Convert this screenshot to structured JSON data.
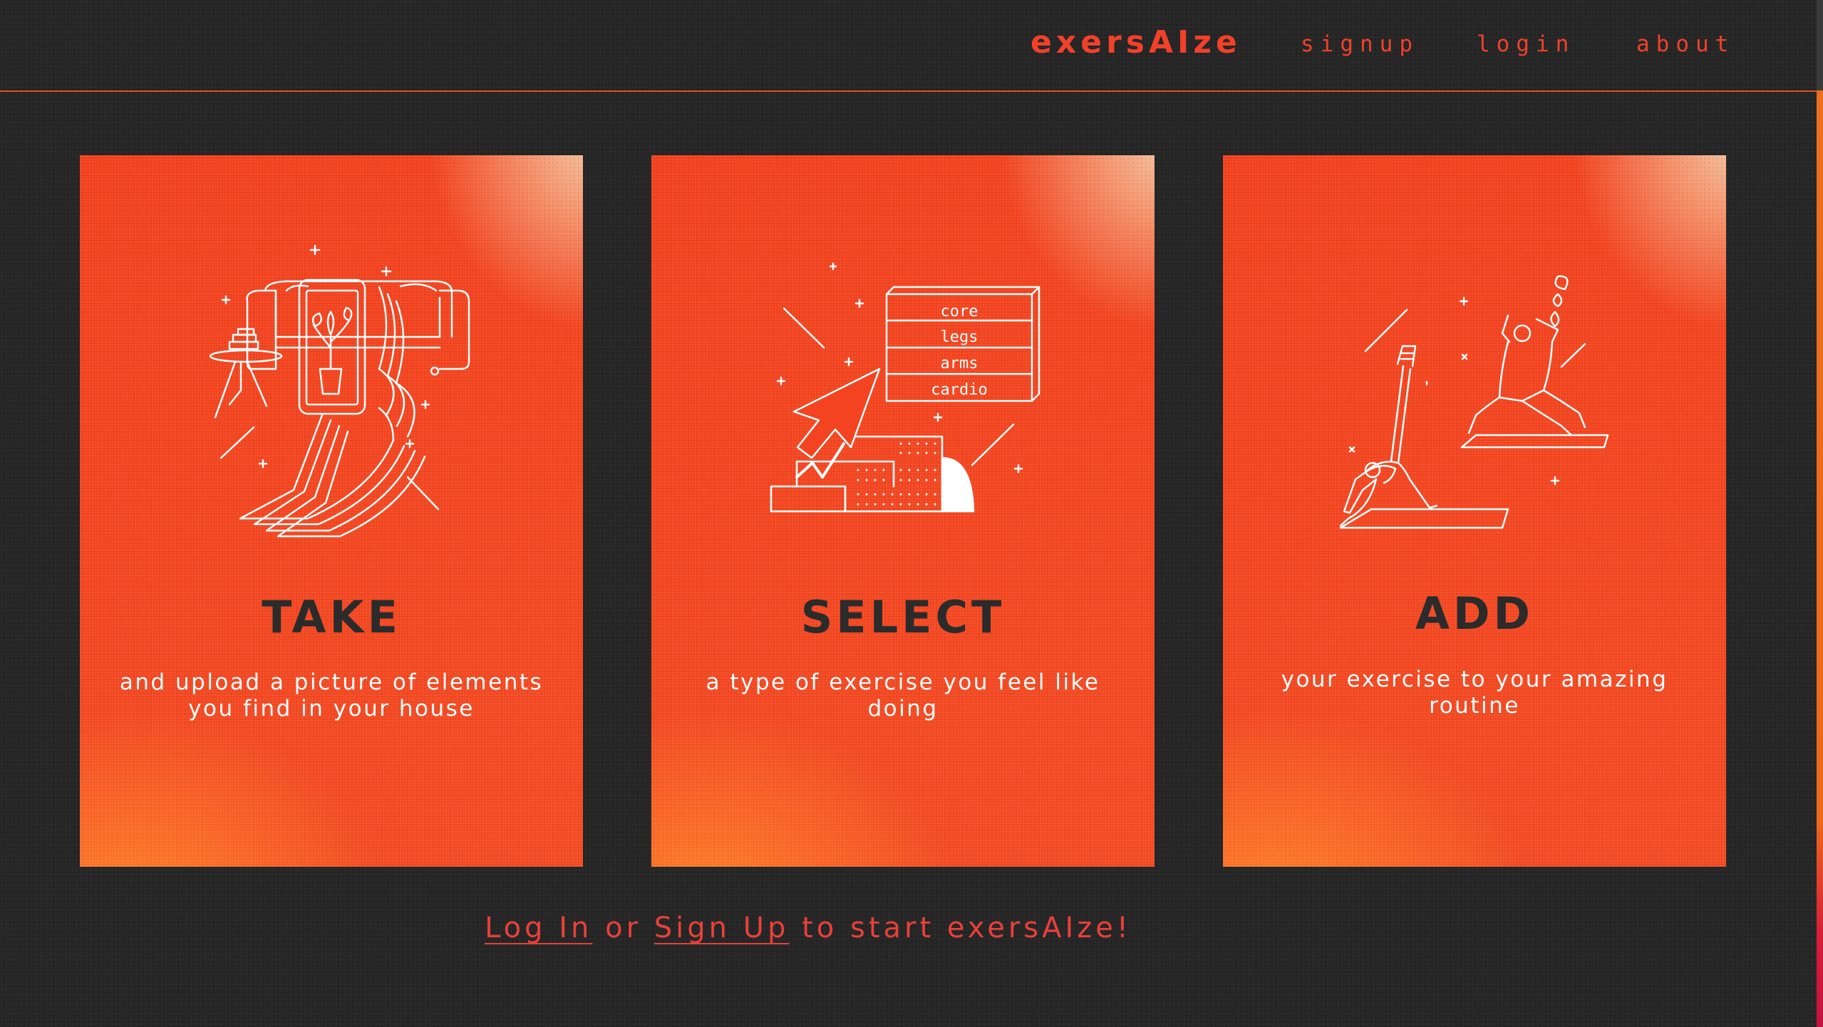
{
  "navbar": {
    "brand": "exersAIze",
    "links": {
      "signup": "signup",
      "login": "login",
      "about": "about"
    }
  },
  "cards": [
    {
      "title": "TAKE",
      "description": "and upload a picture of elements you find in your house",
      "icon": "phone-photo-couch-illustration"
    },
    {
      "title": "SELECT",
      "description": "a type of exercise you feel like doing",
      "icon": "cursor-select-drawers-illustration",
      "drawer_labels": [
        "core",
        "legs",
        "arms",
        "cardio"
      ]
    },
    {
      "title": "ADD",
      "description": "your exercise to your amazing routine",
      "icon": "yoga-people-illustration"
    }
  ],
  "cta": {
    "login_link": "Log In",
    "or": " or ",
    "signup_link": "Sign Up",
    "rest": " to start exersAIze!"
  },
  "colors": {
    "background": "#262626",
    "accent": "#f1412a",
    "card_orange": "#f2401c",
    "card_title": "#2b2b2b"
  }
}
